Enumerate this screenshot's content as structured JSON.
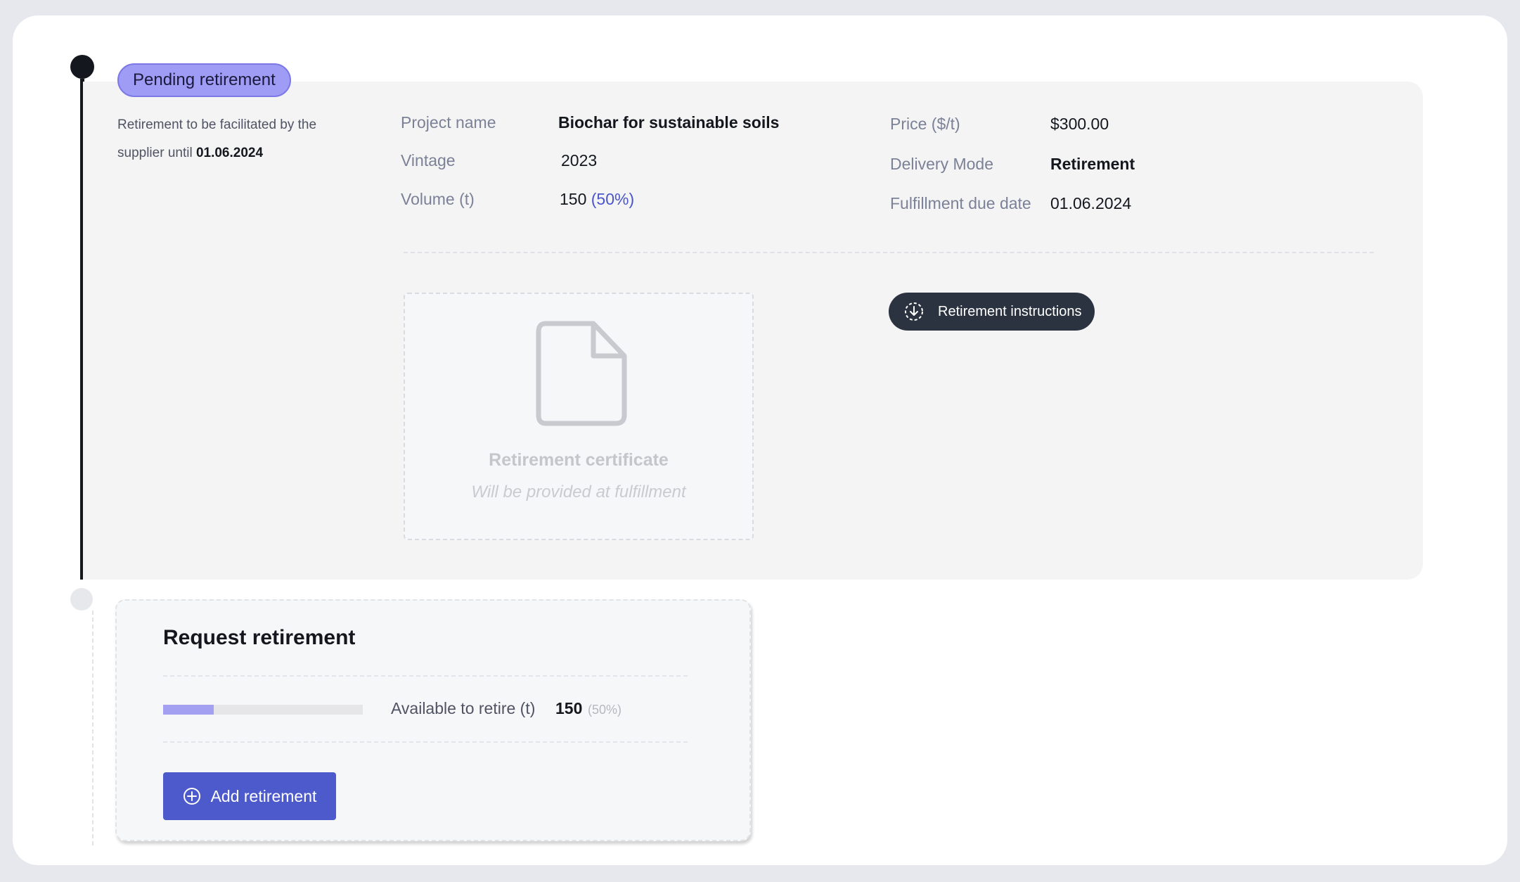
{
  "status": {
    "label": "Pending retirement",
    "description_prefix": "Retirement to be facilitated by the supplier until ",
    "description_date": "01.06.2024"
  },
  "details": {
    "project_name_label": "Project name",
    "project_name": "Biochar for sustainable soils",
    "vintage_label": "Vintage",
    "vintage": "2023",
    "volume_label": "Volume (t)",
    "volume": "150",
    "volume_pct": "(50%)",
    "price_label": "Price ($/t)",
    "price": "$300.00",
    "delivery_mode_label": "Delivery Mode",
    "delivery_mode": "Retirement",
    "due_date_label": "Fulfillment due date",
    "due_date": "01.06.2024"
  },
  "certificate": {
    "title": "Retirement certificate",
    "subtitle": "Will be provided at fulfillment",
    "icon": "document-icon"
  },
  "instructions_button": {
    "label": "Retirement instructions",
    "icon": "download-icon"
  },
  "request": {
    "title": "Request retirement",
    "available_label": "Available to retire (t)",
    "available_value": "150",
    "available_pct": "(50%)",
    "available_fraction": 0.5,
    "add_button_label": "Add retirement",
    "add_icon": "plus-circle-icon"
  },
  "colors": {
    "pill_bg": "#9e9cf4",
    "timeline": "#15171f",
    "primary_button": "#4c5acb",
    "dark_button": "#2c3340",
    "progress_fill": "#a3a0f1"
  }
}
